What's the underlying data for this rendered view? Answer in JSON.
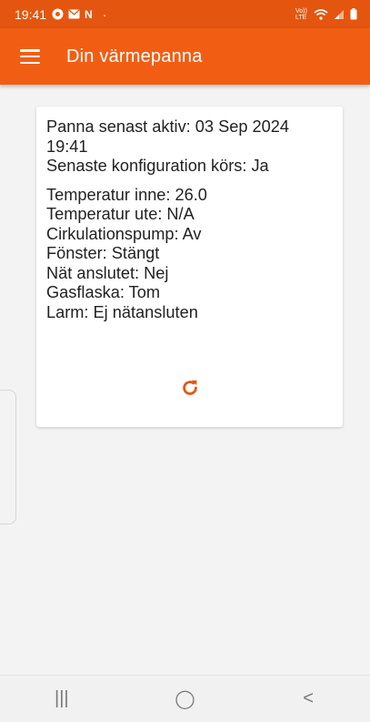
{
  "status_bar": {
    "time": "19:41",
    "left_icons": [
      "notification-dot-icon",
      "mail-icon",
      "n-icon",
      "dot-icon"
    ],
    "right_icons": [
      "volte-icon",
      "wifi-icon",
      "signal-icon",
      "battery-icon"
    ],
    "n_glyph": "N",
    "dot_glyph": "·",
    "volte_glyph": "Vo)) LTE"
  },
  "app_bar": {
    "title": "Din värmepanna",
    "color": "#f15e13"
  },
  "card": {
    "last_active": "Panna senast aktiv: 03 Sep 2024 19:41",
    "config_running": "Senaste konfiguration körs: Ja",
    "temp_inside": "Temperatur inne: 26.0",
    "temp_outside": "Temperatur ute: N/A",
    "circulation_pump": "Cirkulationspump: Av",
    "window": "Fönster: Stängt",
    "grid_connected": "Nät anslutet: Nej",
    "gas_bottle": "Gasflaska: Tom",
    "alarm": "Larm: Ej nätansluten",
    "refresh_icon": "refresh-icon"
  },
  "nav_bar": {
    "recents": "|||",
    "home": "◯",
    "back": "<"
  }
}
